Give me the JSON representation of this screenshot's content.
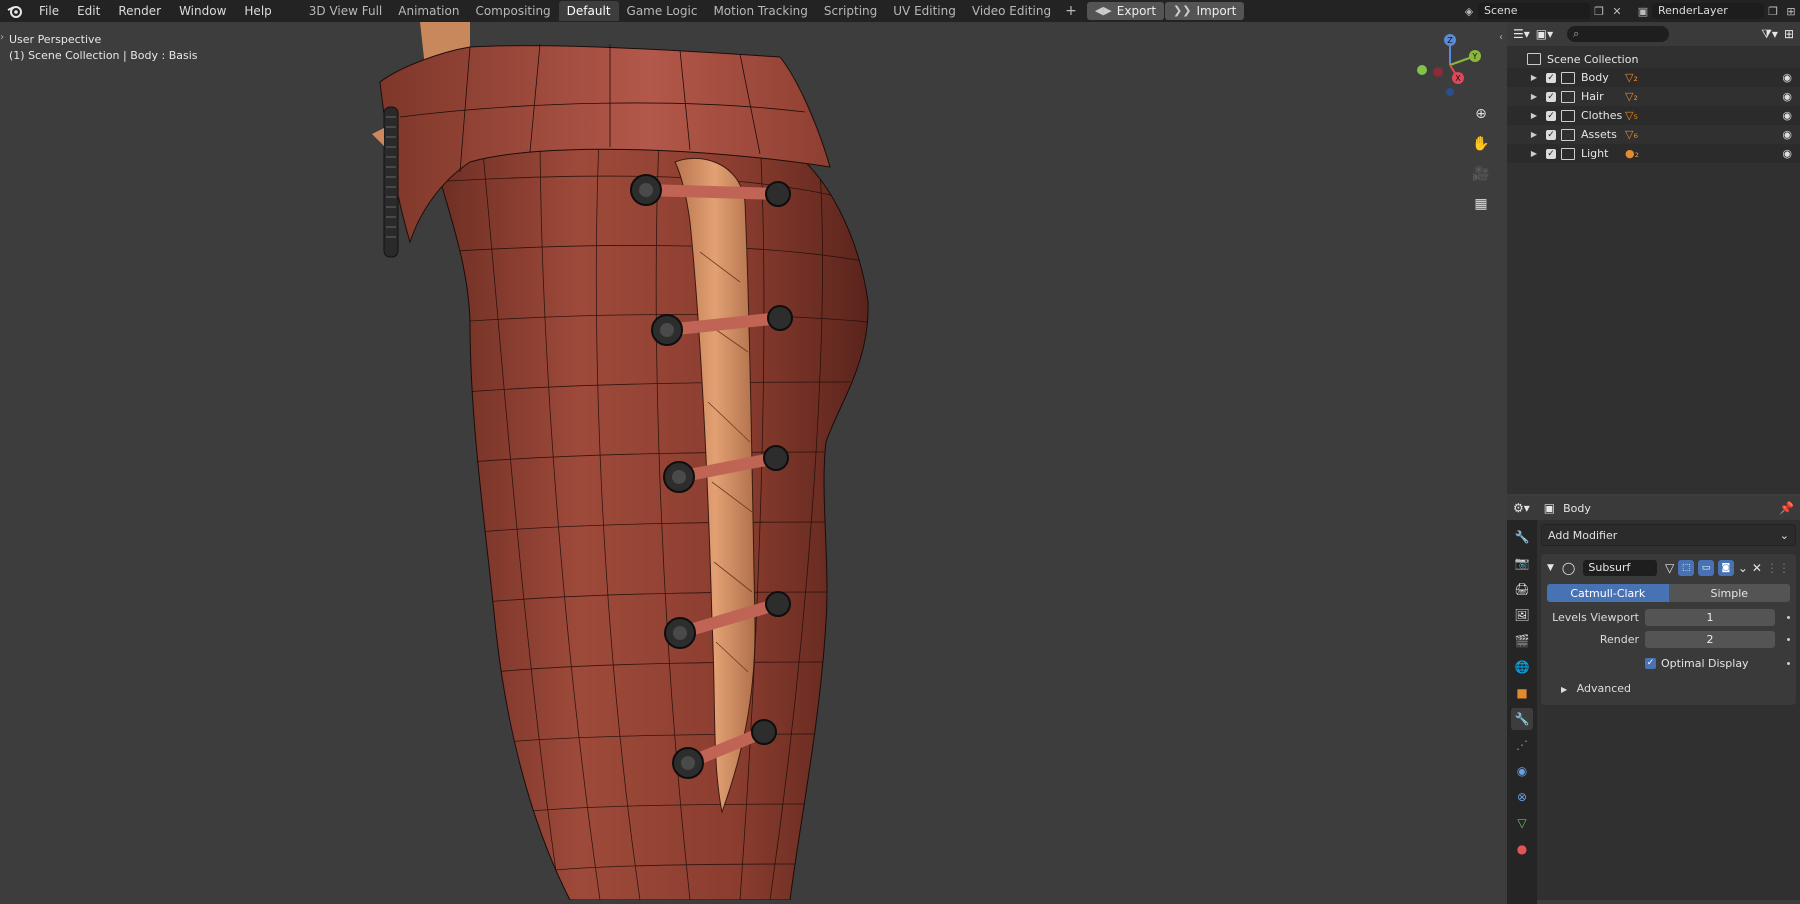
{
  "menu": [
    "File",
    "Edit",
    "Render",
    "Window",
    "Help"
  ],
  "workspaces": {
    "tabs": [
      "3D View Full",
      "Animation",
      "Compositing",
      "Default",
      "Game Logic",
      "Motion Tracking",
      "Scripting",
      "UV Editing",
      "Video Editing"
    ],
    "active": "Default",
    "add_label": "+"
  },
  "export_label": "Export",
  "import_label": "Import",
  "scene_name": "Scene",
  "render_layer_name": "RenderLayer",
  "viewport": {
    "perspective_label": "User Perspective",
    "context_label": "(1) Scene Collection | Body : Basis",
    "gizmo_axes": [
      "Z",
      "Y",
      "X"
    ]
  },
  "outliner": {
    "root_label": "Scene Collection",
    "items": [
      {
        "name": "Body",
        "badge": "▽₂"
      },
      {
        "name": "Hair",
        "badge": "▽₂"
      },
      {
        "name": "Clothes",
        "badge": "▽₅"
      },
      {
        "name": "Assets",
        "badge": "▽₆"
      },
      {
        "name": "Light",
        "badge": "●₂"
      }
    ]
  },
  "properties": {
    "object_name": "Body",
    "add_modifier_label": "Add Modifier",
    "modifier": {
      "name": "Subsurf",
      "algo_catmull": "Catmull-Clark",
      "algo_simple": "Simple",
      "levels_viewport_label": "Levels Viewport",
      "levels_viewport_value": "1",
      "render_label": "Render",
      "render_value": "2",
      "optimal_display_label": "Optimal Display",
      "advanced_label": "Advanced"
    }
  },
  "colors": {
    "accent": "#4772b3",
    "header_bg": "#232323",
    "viewport_bg": "#3d3d3d",
    "mesh_red": "#9b4536",
    "mesh_skin": "#d59466"
  }
}
